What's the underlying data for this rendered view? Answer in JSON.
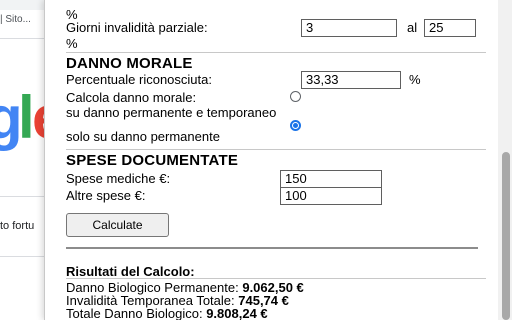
{
  "background": {
    "breadcrumb": "| Sito...",
    "logo_letters": [
      "g",
      "l",
      "e"
    ],
    "snippet": "to fortu"
  },
  "colors": {
    "accent": "#1a73e8",
    "logo": [
      "#4285f4",
      "#34a853",
      "#ea4335"
    ]
  },
  "form": {
    "partial_invalidity": {
      "top_percent": "%",
      "days_label": "Giorni invalidità parziale:",
      "from_value": "3",
      "to_label": "al",
      "to_value": "25",
      "percent": "%"
    },
    "moral_damage": {
      "title": "DANNO MORALE",
      "percent_label": "Percentuale riconosciuta:",
      "percent_value": "33,33",
      "percent_unit": "%",
      "calc_label": "Calcola danno morale:",
      "options": [
        {
          "label": "su danno permanente e temporaneo",
          "checked": false
        },
        {
          "label": "solo su danno permanente",
          "checked": true
        }
      ]
    },
    "expenses": {
      "title": "SPESE DOCUMENTATE",
      "medical_label": "Spese mediche €:",
      "medical_value": "150",
      "other_label": "Altre spese €:",
      "other_value": "100"
    },
    "calculate_label": "Calculate"
  },
  "results": {
    "title": "Risultati del Calcolo:",
    "lines": [
      {
        "label": "Danno Biologico Permanente: ",
        "value": "9.062,50 €"
      },
      {
        "label": "Invalidità Temporanea Totale: ",
        "value": "745,74 €"
      },
      {
        "label": "Totale Danno Biologico: ",
        "value": "9.808,24 €"
      }
    ]
  }
}
